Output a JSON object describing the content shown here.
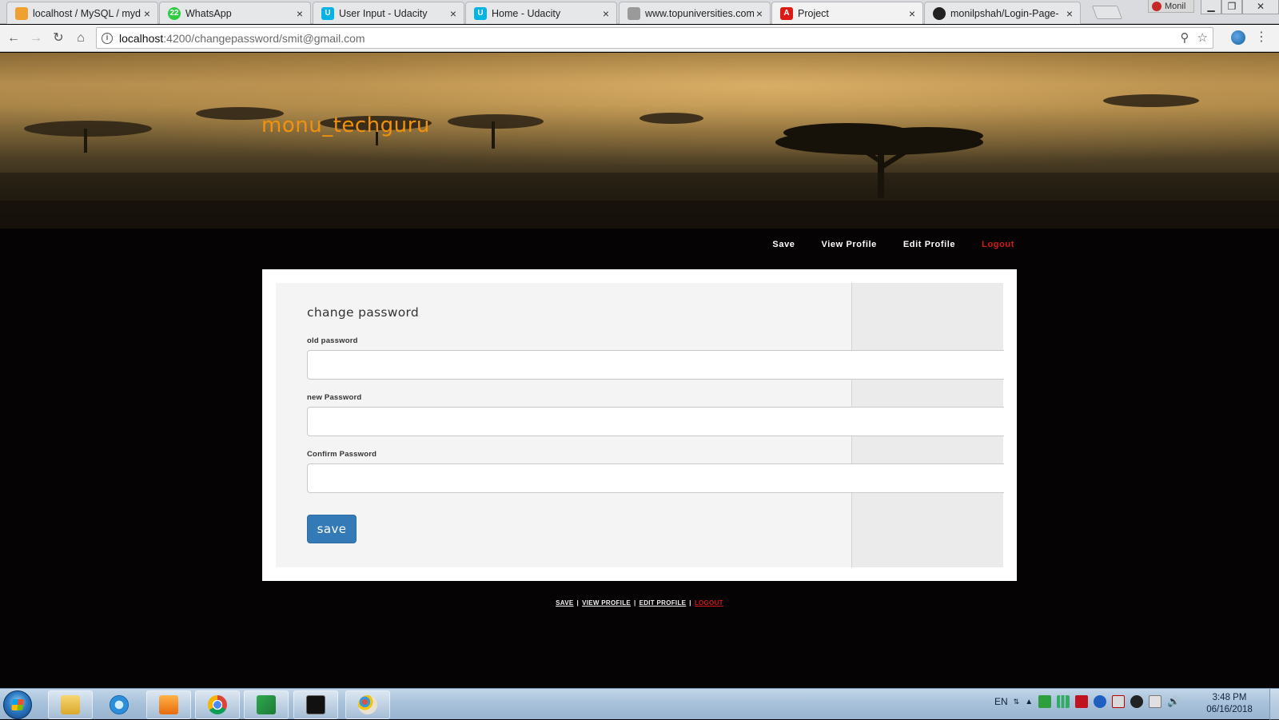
{
  "browser": {
    "tabs": [
      {
        "title": "localhost / MySQL / myd",
        "icon": "phpmyadmin-icon",
        "color": "#f0a030",
        "active": false
      },
      {
        "title": "WhatsApp",
        "icon": "whatsapp-icon",
        "color": "#2ecc40",
        "badge": "22",
        "active": false
      },
      {
        "title": "User Input - Udacity",
        "icon": "udacity-icon",
        "color": "#02b3e4",
        "active": false
      },
      {
        "title": "Home - Udacity",
        "icon": "udacity-icon",
        "color": "#02b3e4",
        "active": false
      },
      {
        "title": "www.topuniversities.com",
        "icon": "globe-icon",
        "color": "#9a9a9a",
        "active": false
      },
      {
        "title": "Project",
        "icon": "angular-icon",
        "color": "#dd1b16",
        "active": true
      },
      {
        "title": "monilpshah/Login-Page-",
        "icon": "github-icon",
        "color": "#222222",
        "active": false
      }
    ],
    "profile_name": "Monil",
    "address": {
      "host": "localhost",
      "path": ":4200/changepassword/smit@gmail.com"
    }
  },
  "page": {
    "brand": "monu_techguru",
    "top_nav": [
      "Save",
      "View Profile",
      "Edit Profile",
      "Logout"
    ],
    "form": {
      "title": "change password",
      "fields": [
        {
          "label": "old password",
          "value": ""
        },
        {
          "label": "new Password",
          "value": ""
        },
        {
          "label": "Confirm Password",
          "value": ""
        }
      ],
      "submit_label": "save"
    },
    "footer_nav": [
      "SAVE",
      "VIEW PROFILE",
      "EDIT PROFILE",
      "LOGOUT"
    ],
    "colors": {
      "brand": "#f2920c",
      "logout": "#d21a1a",
      "button": "#337ab7"
    }
  },
  "taskbar": {
    "apps": [
      "windows-explorer-icon",
      "internet-explorer-icon",
      "media-player-icon",
      "chrome-icon",
      "visual-studio-code-icon",
      "command-prompt-icon",
      "paint-icon"
    ],
    "language": "EN",
    "time": "3:48 PM",
    "date": "06/16/2018"
  }
}
